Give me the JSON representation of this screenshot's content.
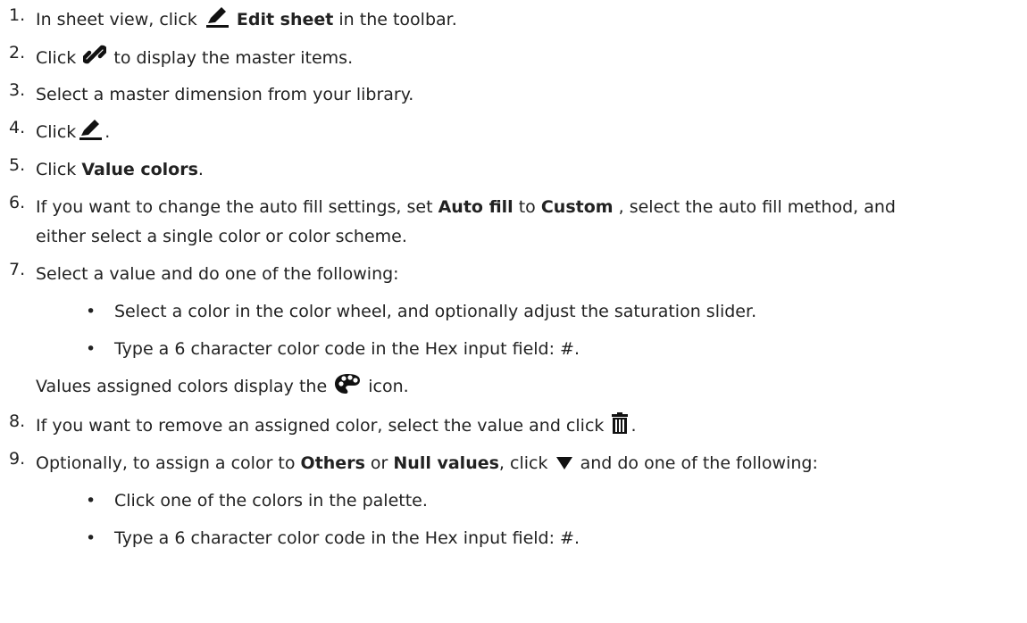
{
  "steps": [
    {
      "num": "1.",
      "a": "In sheet view, click",
      "b": "Edit sheet",
      "c": "in the toolbar."
    },
    {
      "num": "2.",
      "a": "Click",
      "b": "to display the master items."
    },
    {
      "num": "3.",
      "a": "Select a master dimension from your library."
    },
    {
      "num": "4.",
      "a": "Click",
      "b": "."
    },
    {
      "num": "5.",
      "a": "Click",
      "b": "Value colors",
      "c": "."
    },
    {
      "num": "6.",
      "a": "If you want to change the auto fill settings, set",
      "b": "Auto fill",
      "c": "to",
      "d": "Custom",
      "e": ", select the auto fill method, and",
      "f": "either select a single color or color scheme."
    },
    {
      "num": "7.",
      "a": "Select a value and do one of the following:",
      "bullets": [
        "Select a color in the color wheel, and optionally adjust the saturation slider.",
        "Type a 6 character color code in the Hex input field: #."
      ],
      "note_a": "Values assigned colors display the",
      "note_b": "icon."
    },
    {
      "num": "8.",
      "a": "If you want to remove an assigned color, select the value and click",
      "b": "."
    },
    {
      "num": "9.",
      "a": "Optionally, to assign a color to",
      "b": "Others",
      "c": "or",
      "d": "Null values",
      "e": ", click",
      "f": "and do one of the following:",
      "bullets": [
        "Click one of the colors in the palette.",
        "Type a 6 character color code in the Hex input field: #."
      ]
    }
  ],
  "bullet_char": "•",
  "icons": {
    "edit": "pencil-icon",
    "link": "link-icon",
    "palette": "palette-icon",
    "delete": "trash-icon",
    "dropdown": "triangle-down-icon"
  }
}
